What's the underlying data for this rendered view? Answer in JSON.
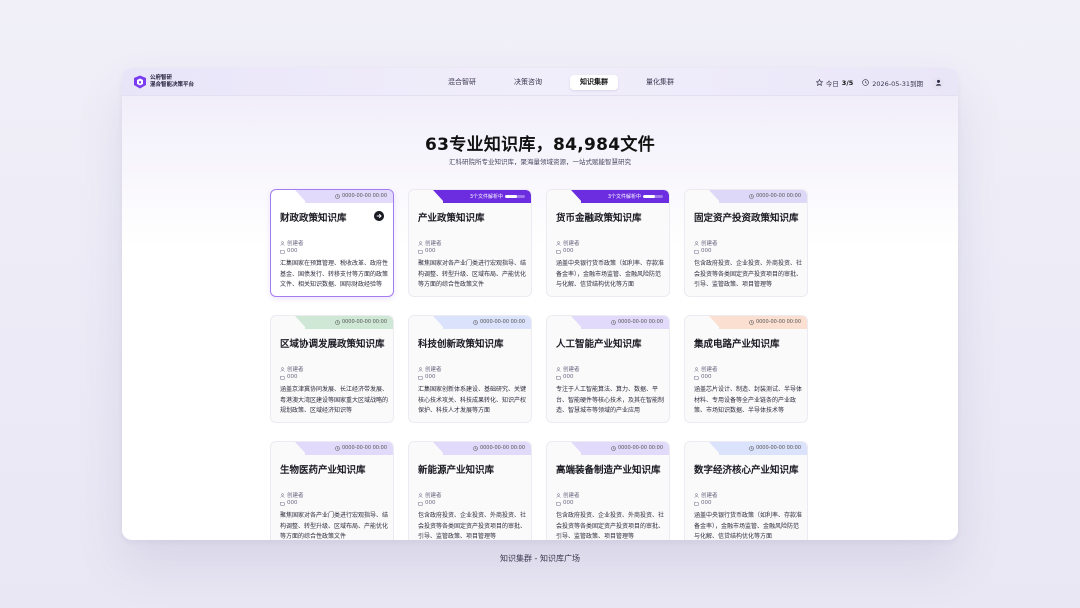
{
  "brand": {
    "line1": "公府智研",
    "line2": "混合智能决策平台",
    "accent": "#7a3cf0"
  },
  "nav": [
    {
      "label": "混合智研",
      "active": false
    },
    {
      "label": "决策咨询",
      "active": false
    },
    {
      "label": "知识集群",
      "active": true
    },
    {
      "label": "量化集群",
      "active": false
    }
  ],
  "status": {
    "today_label": "今日",
    "today_value": "3/5",
    "expiry": "2026-05-31到期"
  },
  "hero": {
    "title": "63专业知识库，84,984文件",
    "subtitle": "汇科研院所专业知识库，聚海量领域资源，一站式赋能智慧研究"
  },
  "card_labels": {
    "creator": "创建者",
    "count": "000"
  },
  "cards": [
    {
      "title": "财政政策知识库",
      "tab": "0000-00-00 00:00",
      "tab_color": "#e2dafb",
      "parsing": false,
      "selected": true,
      "desc": "汇集国家在预算管理、税收改革、政府性基金、国债发行、转移支付等方面的政策文件、相关知识数据、国际财政经验等"
    },
    {
      "title": "产业政策知识库",
      "tab": "3个文件解析中",
      "tab_color": "#6c2ce0",
      "parsing": true,
      "progress": 0.6,
      "selected": false,
      "desc": "聚焦国家对各产业门类进行宏观指导、结构调整、转型升级、区域布局、产能优化等方面的综合性政策文件"
    },
    {
      "title": "货币金融政策知识库",
      "tab": "3个文件解析中",
      "tab_color": "#6c2ce0",
      "parsing": true,
      "progress": 0.6,
      "selected": false,
      "desc": "涵盖中央银行货币政策（如利率、存款准备金率），金融市场监管、金融风险防范与化解、信贷结构优化等方面"
    },
    {
      "title": "固定资产投资政策知识库",
      "tab": "0000-00-00 00:00",
      "tab_color": "#ded8f8",
      "parsing": false,
      "selected": false,
      "desc": "包含政府投资、企业投资、外商投资、社会投资等各类固定资产投资项目的审批、引导、监管政策、项目管理等"
    },
    {
      "title": "区域协调发展政策知识库",
      "tab": "0000-00-00 00:00",
      "tab_color": "#cfe8d6",
      "parsing": false,
      "selected": false,
      "desc": "涵盖京津冀协同发展、长江经济带发展、粤港澳大湾区建设等国家重大区域战略的规划政策、区域经济知识等"
    },
    {
      "title": "科技创新政策知识库",
      "tab": "0000-00-00 00:00",
      "tab_color": "#dbe2fb",
      "parsing": false,
      "selected": false,
      "desc": "汇集国家创新体系建设、基础研究、关键核心技术攻关、科技成果转化、知识产权保护、科技人才发展等方面"
    },
    {
      "title": "人工智能产业知识库",
      "tab": "0000-00-00 00:00",
      "tab_color": "#e2dafb",
      "parsing": false,
      "selected": false,
      "desc": "专注于人工智能算法、算力、数据、平台、智能硬件等核心技术，及其在智能制造、智慧城市等领域的产业应用"
    },
    {
      "title": "集成电路产业知识库",
      "tab": "0000-00-00 00:00",
      "tab_color": "#fbe0d2",
      "parsing": false,
      "selected": false,
      "desc": "涵盖芯片设计、制造、封装测试、半导体材料、专用设备等全产业链条的产业政策、市场知识数据、半导体技术等"
    },
    {
      "title": "生物医药产业知识库",
      "tab": "0000-00-00 00:00",
      "tab_color": "#e2dafb",
      "parsing": false,
      "selected": false,
      "desc": "聚焦国家对各产业门类进行宏观指导、结构调整、转型升级、区域布局、产能优化等方面的综合性政策文件"
    },
    {
      "title": "新能源产业知识库",
      "tab": "0000-00-00 00:00",
      "tab_color": "#e2dafb",
      "parsing": false,
      "selected": false,
      "desc": "包含政府投资、企业投资、外商投资、社会投资等各类固定资产投资项目的审批、引导、监管政策、项目管理等"
    },
    {
      "title": "高端装备制造产业知识库",
      "tab": "0000-00-00 00:00",
      "tab_color": "#e2dafb",
      "parsing": false,
      "selected": false,
      "desc": "包含政府投资、企业投资、外商投资、社会投资等各类固定资产投资项目的审批、引导、监管政策、项目管理等"
    },
    {
      "title": "数字经济核心产业知识库",
      "tab": "0000-00-00 00:00",
      "tab_color": "#dbe2fb",
      "parsing": false,
      "selected": false,
      "desc": "涵盖中央银行货币政策（如利率、存款准备金率），金融市场监管、金融风险防范与化解、信贷结构优化等方面"
    }
  ],
  "footer": "知识集群 - 知识库广场"
}
